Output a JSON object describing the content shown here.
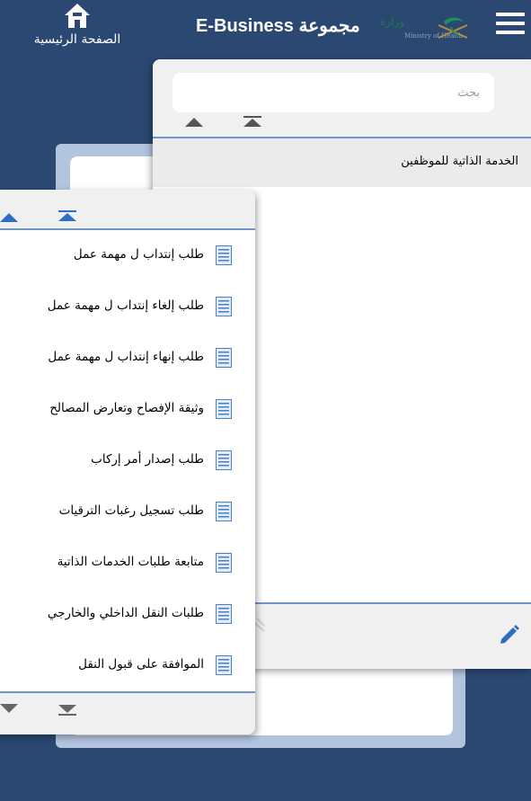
{
  "header": {
    "home_label": "الصفحة الرئيسية",
    "title": "E-Business مجموعة",
    "logo": {
      "arabic": "وزارة الصحة",
      "english": "Ministry of Health"
    }
  },
  "right_panel": {
    "search_placeholder": "بحث",
    "section_title": "الخدمة الذاتية للموظفين"
  },
  "left_panel": {
    "items": [
      {
        "label": "طلب إنتداب ل مهمة عمل"
      },
      {
        "label": "طلب إلغاء إنتداب ل مهمة عمل"
      },
      {
        "label": "طلب إنهاء إنتداب ل مهمة عمل"
      },
      {
        "label": "وثيقة الإفصاح وتعارض المصالح"
      },
      {
        "label": "طلب إصدار أمر إركاب"
      },
      {
        "label": "طلب تسجيل رغبات الترقيات"
      },
      {
        "label": "متابعة طلبات الخدمات الذاتية"
      },
      {
        "label": "طلبات النقل الداخلي والخارجي"
      },
      {
        "label": "الموافقة على قبول النقل"
      }
    ]
  },
  "colors": {
    "background": "#2a4872",
    "separator": "#6e96c8",
    "back_panel": "#b3c4de",
    "icon_blue": "#2e6fc4"
  },
  "icons": [
    "home-icon",
    "hamburger-menu-icon",
    "moh-logo",
    "document-icon",
    "pencil-icon",
    "arrow-up-icon",
    "scroll-to-top-icon",
    "arrow-down-icon",
    "scroll-to-bottom-icon"
  ]
}
